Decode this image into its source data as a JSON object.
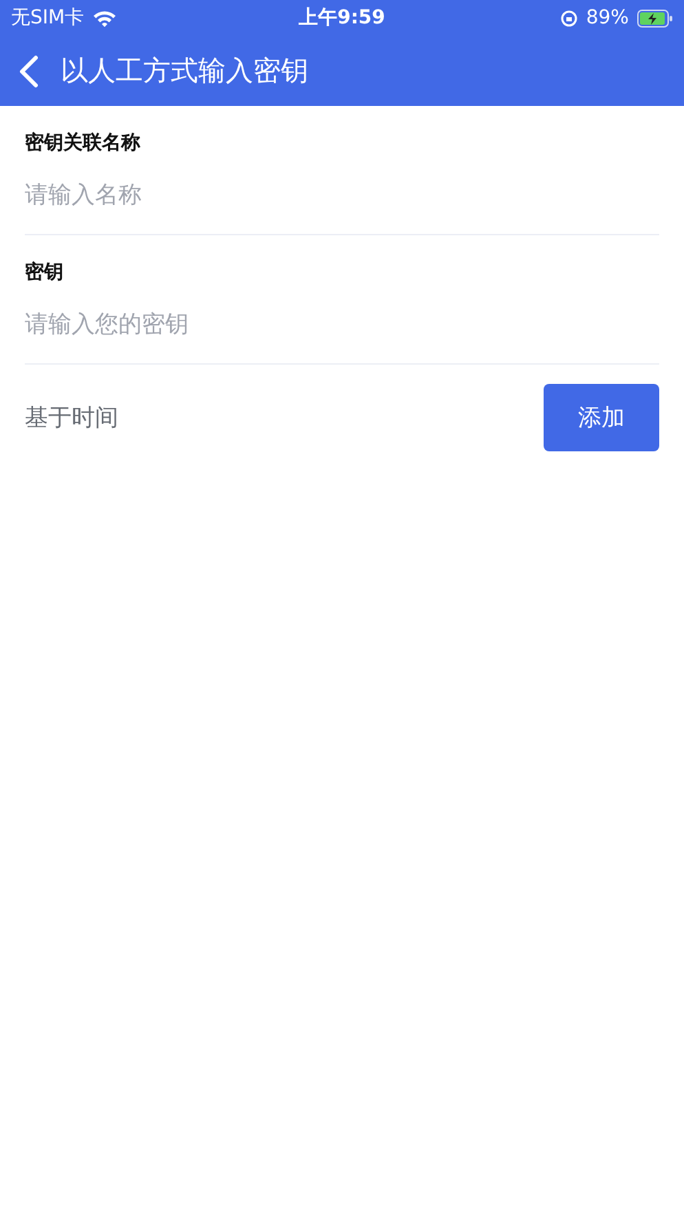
{
  "status_bar": {
    "carrier": "无SIM卡",
    "time": "上午9:59",
    "battery": "89%"
  },
  "nav": {
    "title": "以人工方式输入密钥"
  },
  "fields": [
    {
      "label": "密钥关联名称",
      "placeholder": "请输入名称"
    },
    {
      "label": "密钥",
      "placeholder": "请输入您的密钥"
    }
  ],
  "mode": {
    "label": "基于时间"
  },
  "add_button": "添加"
}
